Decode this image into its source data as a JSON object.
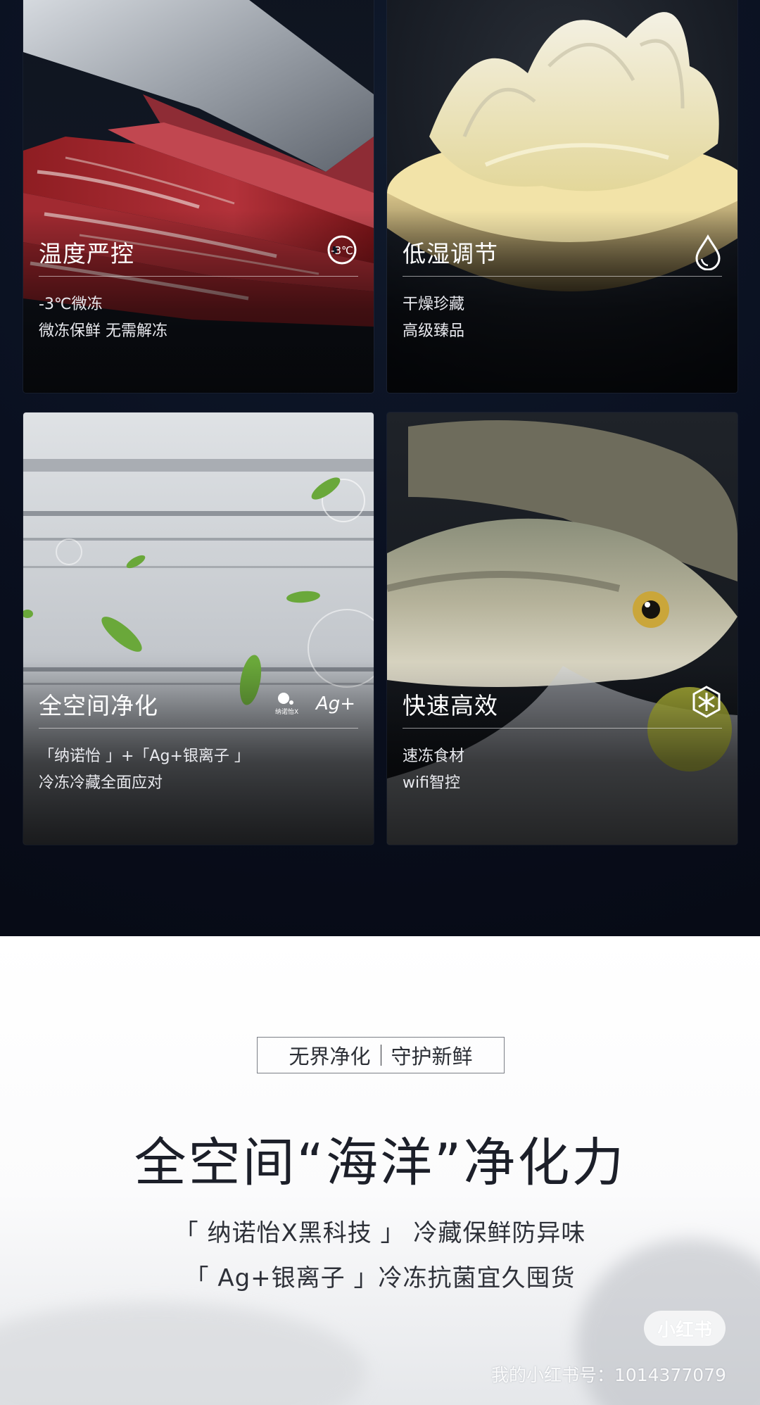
{
  "cards": [
    {
      "title": "温度严控",
      "icon": "thermo-minus-3-icon",
      "icon_text": "-3°C",
      "line1": "-3℃微冻",
      "line2": "微冻保鲜 无需解冻"
    },
    {
      "title": "低湿调节",
      "icon": "water-drop-icon",
      "line1": "干燥珍藏",
      "line2": "高级臻品"
    },
    {
      "title": "全空间净化",
      "icon": "purification-logos-icon",
      "icon_text_a": "纳诺怡X",
      "icon_text_b": "Ag+",
      "line1": "「纳诺怡 」+「Ag+银离子 」",
      "line2": "冷冻冷藏全面应对"
    },
    {
      "title": "快速高效",
      "icon": "snowflake-icon",
      "line1": "速冻食材",
      "line2": "wifi智控"
    }
  ],
  "tagline": {
    "left": "无界净化",
    "right": "守护新鲜"
  },
  "headline": "全空间“海洋”净化力",
  "sublines": [
    "「 纳诺怡X黑科技 」 冷藏保鲜防异味",
    "「 Ag+银离子 」冷冻抗菌宜久囤货"
  ],
  "watermark": {
    "badge": "小红书",
    "id_text": "我的小红书号：1014377079"
  }
}
